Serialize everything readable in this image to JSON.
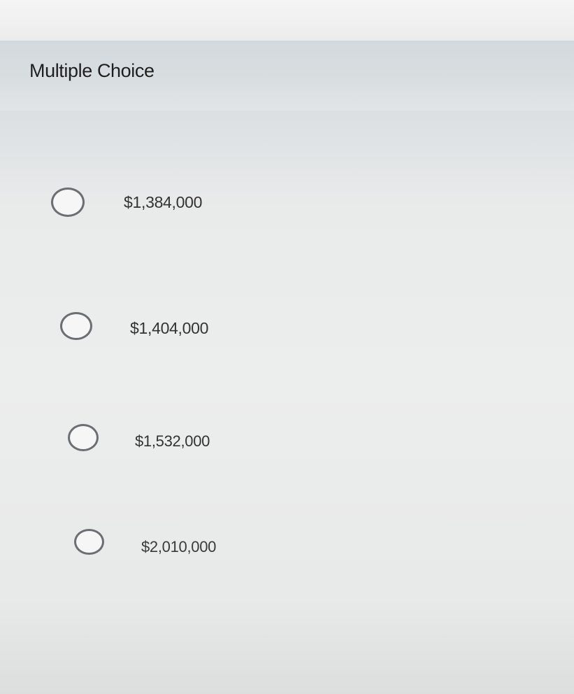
{
  "question": {
    "title": "Multiple Choice",
    "options": [
      {
        "label": "$1,384,000"
      },
      {
        "label": "$1,404,000"
      },
      {
        "label": "$1,532,000"
      },
      {
        "label": "$2,010,000"
      }
    ]
  }
}
